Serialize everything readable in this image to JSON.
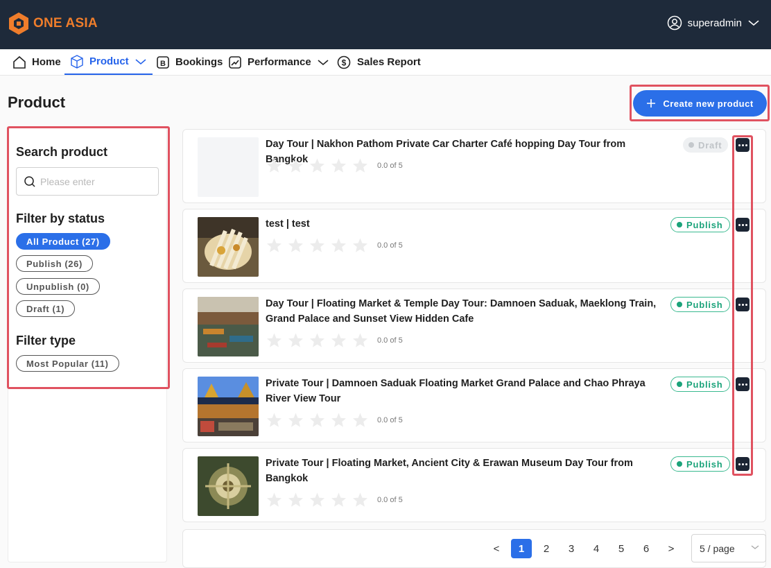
{
  "brand": {
    "name": "ONE ASIA",
    "color": "#ef7d2b"
  },
  "user": {
    "name": "superadmin"
  },
  "nav": [
    {
      "label": "Home",
      "icon": "home-icon"
    },
    {
      "label": "Product",
      "icon": "box-icon",
      "active": true
    },
    {
      "label": "Bookings",
      "icon": "bookings-icon"
    },
    {
      "label": "Performance",
      "icon": "trend-icon"
    },
    {
      "label": "Sales Report",
      "icon": "money-icon"
    }
  ],
  "page": {
    "title": "Product",
    "create_label": "Create new product"
  },
  "sidebar": {
    "search_heading": "Search product",
    "search_placeholder": "Please enter",
    "status_heading": "Filter by status",
    "status_filters": [
      "All Product (27)",
      "Publish (26)",
      "Unpublish (0)",
      "Draft (1)"
    ],
    "type_heading": "Filter type",
    "type_filters": [
      "Most Popular (11)"
    ]
  },
  "products": [
    {
      "title": "Day Tour | Nakhon Pathom Private Car Charter Café hopping Day Tour from Bangkok",
      "rating": "0.0 of 5",
      "rating_value": 0,
      "status": "Draft"
    },
    {
      "title": "test | test",
      "rating": "0.0 of 5",
      "rating_value": 0,
      "status": "Publish"
    },
    {
      "title": "Day Tour | Floating Market & Temple Day Tour: Damnoen Saduak, Maeklong Train, Grand Palace and Sunset View Hidden Cafe",
      "rating": "0.0 of 5",
      "rating_value": 0,
      "status": "Publish"
    },
    {
      "title": "Private Tour | Damnoen Saduak Floating Market Grand Palace and Chao Phraya River View Tour",
      "rating": "0.0 of 5",
      "rating_value": 0,
      "status": "Publish"
    },
    {
      "title": "Private Tour | Floating Market, Ancient City & Erawan Museum Day Tour from Bangkok",
      "rating": "0.0 of 5",
      "rating_value": 0,
      "status": "Publish"
    }
  ],
  "pagination": {
    "pages": [
      "1",
      "2",
      "3",
      "4",
      "5",
      "6"
    ],
    "current": "1",
    "prev": "<",
    "next": ">",
    "page_size": "5 / page"
  },
  "colors": {
    "accent": "#2b6fe8",
    "topbar": "#1e2a3a",
    "publish": "#1ba37a",
    "highlight": "#e05260"
  }
}
